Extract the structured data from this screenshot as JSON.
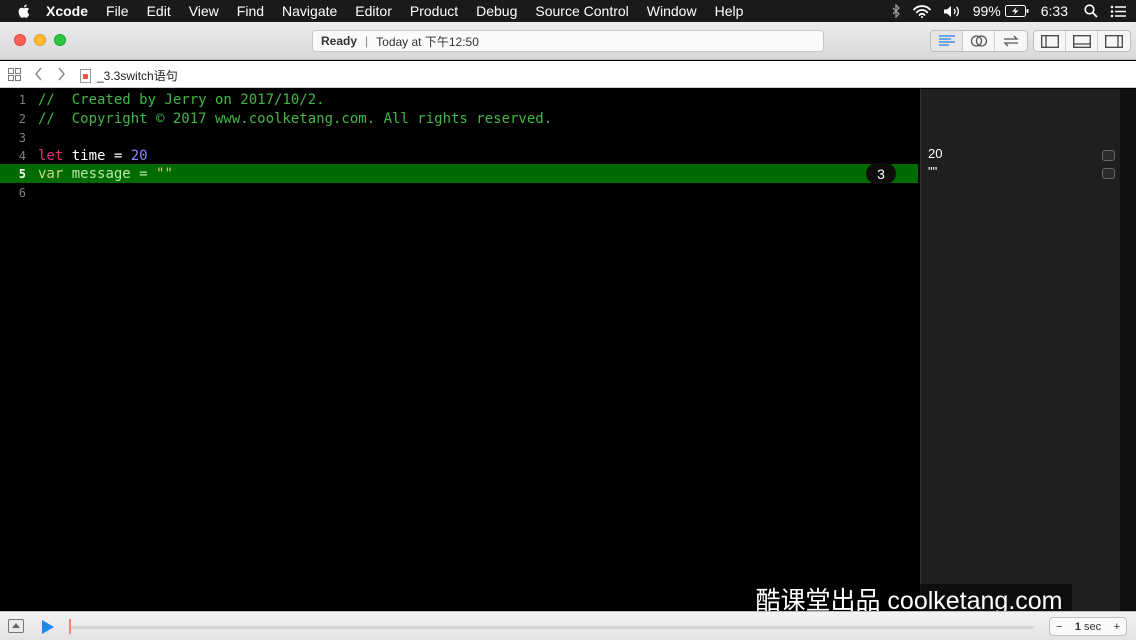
{
  "menubar": {
    "app": "Xcode",
    "items": [
      "File",
      "Edit",
      "View",
      "Find",
      "Navigate",
      "Editor",
      "Product",
      "Debug",
      "Source Control",
      "Window",
      "Help"
    ],
    "battery": "99%",
    "time": "6:33"
  },
  "toolbar": {
    "status_bold": "Ready",
    "status_separator": "|",
    "status_detail": "Today at 下午12:50"
  },
  "jumpbar": {
    "file": "_3.3switch语句"
  },
  "editor": {
    "lines": [
      {
        "num": "1",
        "text": "//  Created by Jerry on 2017/10/2."
      },
      {
        "num": "2",
        "text": "//  Copyright © 2017 www.coolketang.com. All rights reserved."
      },
      {
        "num": "3",
        "text": ""
      },
      {
        "num": "4",
        "kw": "let",
        "name": " time = ",
        "value": "20"
      },
      {
        "num": "5",
        "kw": "var",
        "name": " message = ",
        "value": "\"\""
      },
      {
        "num": "6",
        "text": ""
      }
    ],
    "execution_count": "3"
  },
  "results": [
    {
      "line": "4",
      "value": "20"
    },
    {
      "line": "5",
      "value": "\"\""
    }
  ],
  "watermark": "酷课堂出品 coolketang.com",
  "bottombar": {
    "timer_minus": "−",
    "timer_value": "1",
    "timer_unit": "sec",
    "timer_plus": "+"
  },
  "colors": {
    "comment": "#41b645",
    "keyword": "#e0317c",
    "number": "#8b87ff",
    "string": "#f56b3f",
    "highlight_line": "#006b00",
    "play_button": "#1e88f0"
  }
}
